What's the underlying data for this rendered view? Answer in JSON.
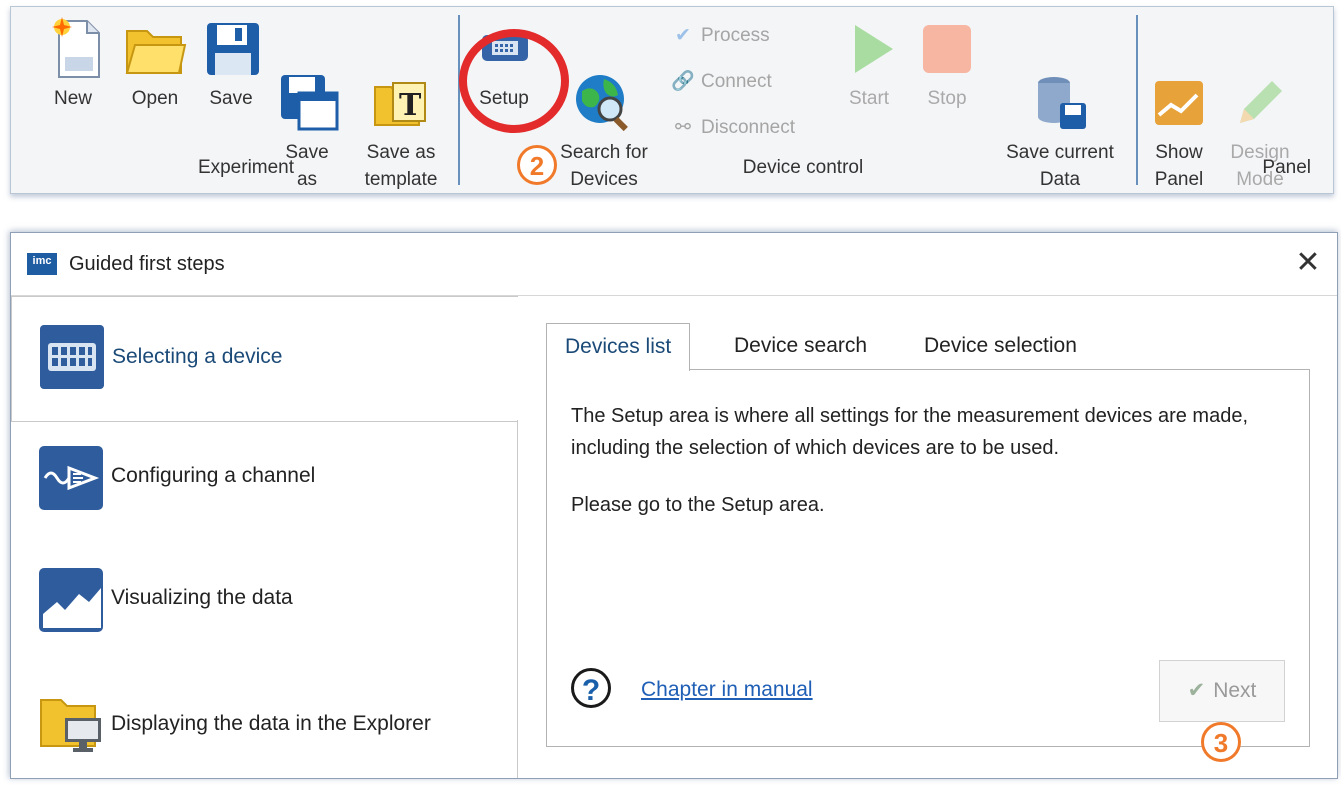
{
  "ribbon": {
    "experiment": {
      "group_label": "Experiment",
      "new_label": "New",
      "open_label": "Open",
      "save_label": "Save",
      "save_as_label": "Save\nas",
      "save_as_template_label": "Save as\ntemplate"
    },
    "device_control": {
      "group_label": "Device control",
      "setup_label": "Setup",
      "search_label": "Search for\nDevices",
      "process_label": "Process",
      "connect_label": "Connect",
      "disconnect_label": "Disconnect",
      "start_label": "Start",
      "stop_label": "Stop",
      "save_current_label": "Save current\nData"
    },
    "panel": {
      "group_label": "Panel",
      "show_panel_label": "Show\nPanel",
      "design_mode_label": "Design\nMode"
    },
    "callout_setup": "2"
  },
  "dialog": {
    "app_icon_text": "imc",
    "title": "Guided first steps",
    "close_glyph": "✕",
    "steps": [
      {
        "label": "Selecting a device",
        "icon": "device-icon",
        "active": true
      },
      {
        "label": "Configuring a channel",
        "icon": "channel-icon",
        "active": false
      },
      {
        "label": "Visualizing the data",
        "icon": "chart-icon",
        "active": false
      },
      {
        "label": "Displaying the data in the Explorer",
        "icon": "explorer-folder-icon",
        "active": false
      }
    ],
    "tabs": [
      {
        "label": "Devices list",
        "active": true
      },
      {
        "label": "Device search",
        "active": false
      },
      {
        "label": "Device selection",
        "active": false
      }
    ],
    "panel_text_1": "The Setup area is where all settings for the measurement devices are made, including the selection of which devices are to be used.",
    "panel_text_2": "Please go to the Setup area.",
    "help_glyph": "?",
    "manual_link": "Chapter in manual",
    "next_label": "Next",
    "next_glyph": "✔",
    "callout_next": "3"
  },
  "colors": {
    "accent_blue": "#1f5da3",
    "highlight_red": "#e32b2b",
    "callout_orange": "#f07a2a",
    "link_blue": "#1f5fb5"
  }
}
